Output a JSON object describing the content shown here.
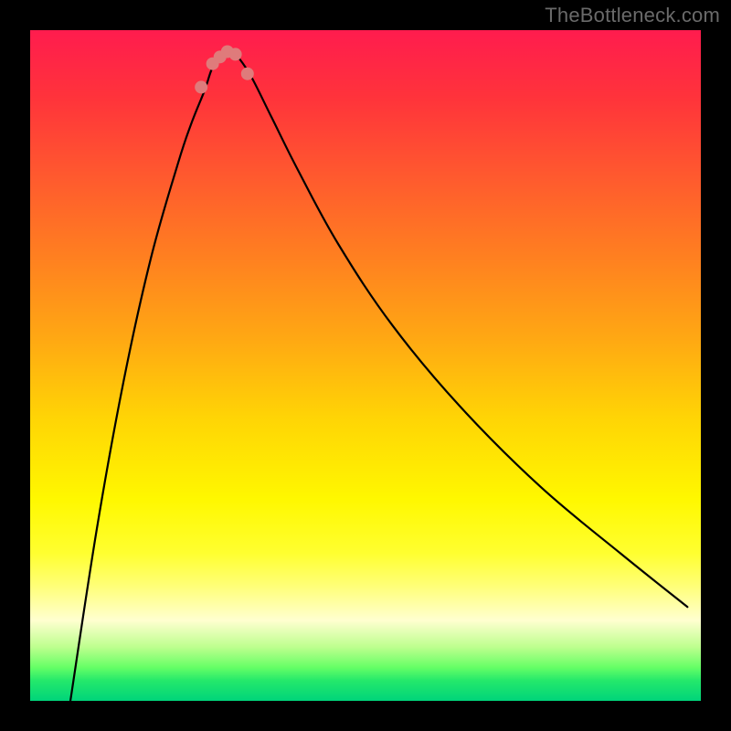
{
  "watermark": "TheBottleneck.com",
  "chart_data": {
    "type": "line",
    "title": "",
    "xlabel": "",
    "ylabel": "",
    "xlim": [
      0,
      100
    ],
    "ylim": [
      0,
      100
    ],
    "series": [
      {
        "name": "curve",
        "x": [
          6,
          10,
          14,
          18,
          22,
          24,
          26,
          27,
          28,
          29,
          30,
          31,
          33,
          36,
          40,
          46,
          54,
          64,
          76,
          88,
          98
        ],
        "y": [
          0,
          26,
          48,
          66,
          80,
          86,
          91,
          94,
          96,
          97,
          97,
          96,
          93,
          87,
          79,
          68,
          56,
          44,
          32,
          22,
          14
        ]
      }
    ],
    "markers": {
      "name": "bottom-dots",
      "x": [
        25.5,
        27.2,
        28.3,
        29.4,
        30.6,
        32.4
      ],
      "y": [
        91.5,
        95.0,
        96.0,
        96.8,
        96.4,
        93.5
      ]
    },
    "gradient": {
      "top_color": "#ff1c4e",
      "bottom_color": "#00d47a"
    }
  }
}
